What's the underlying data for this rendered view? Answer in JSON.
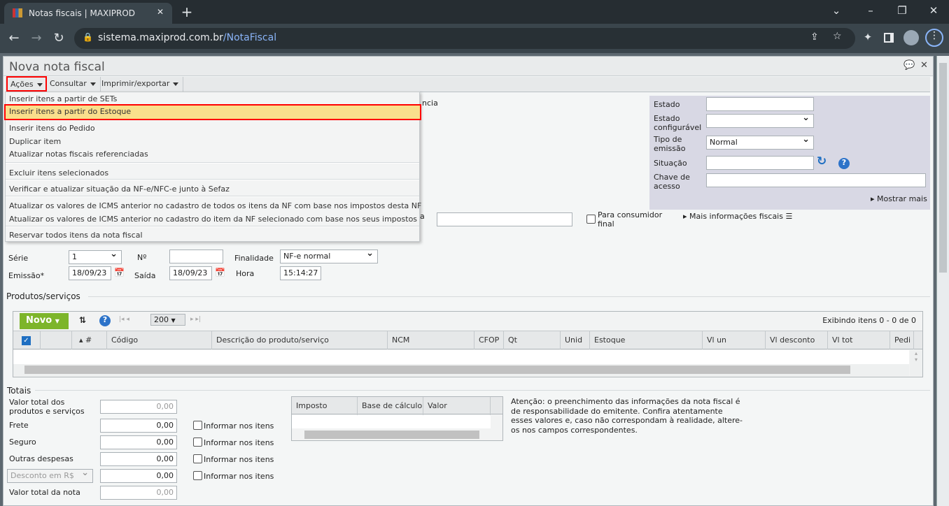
{
  "browser": {
    "tab_title": "Notas fiscais | MAXIPROD",
    "url_host": "sistema.maxiprod.com.br",
    "url_path": "/NotaFiscal"
  },
  "window": {
    "title": "Nova nota fiscal"
  },
  "toolbar": {
    "acoes": "Ações",
    "consultar": "Consultar",
    "imprimir": "Imprimir/exportar"
  },
  "menu": {
    "items": [
      "Inserir itens a partir de SETs",
      "Inserir itens a partir do Estoque",
      "Inserir itens do Pedido",
      "Duplicar item",
      "Atualizar notas fiscais referenciadas",
      "Excluir itens selecionados",
      "Verificar e atualizar situação da NF-e/NFC-e junto à Sefaz",
      "Atualizar os valores de ICMS anterior no cadastro de todos os itens da NF com base nos impostos desta NF",
      "Atualizar os valores de ICMS anterior no cadastro do item da NF selecionado com base nos seus impostos",
      "Reservar todos itens da nota fiscal"
    ]
  },
  "partial": {
    "ncia": "ncia",
    "a": "a"
  },
  "status_panel": {
    "estado": "Estado",
    "estado_conf": "Estado configurável",
    "tipo_emissao": "Tipo de emissão",
    "tipo_emissao_value": "Normal",
    "situacao": "Situação",
    "chave": "Chave de acesso",
    "mostrar_mais": "Mostrar mais"
  },
  "fiscal": {
    "consumidor_final": "Para consumidor final",
    "mais_info": "Mais informações fiscais"
  },
  "header_fields": {
    "serie_label": "Série",
    "serie_value": "1",
    "numero_label": "Nº",
    "finalidade_label": "Finalidade",
    "finalidade_value": "NF-e normal",
    "emissao_label": "Emissão*",
    "emissao_value": "18/09/23",
    "saida_label": "Saída",
    "saida_value": "18/09/23",
    "hora_label": "Hora",
    "hora_value": "15:14:27"
  },
  "products": {
    "section": "Produtos/serviços",
    "novo": "Novo",
    "page_size": "200",
    "status": "Exibindo itens 0 - 0 de 0",
    "columns": [
      "#",
      "Código",
      "Descrição do produto/serviço",
      "NCM",
      "CFOP",
      "Qt",
      "Unid",
      "Estoque",
      "Vl un",
      "Vl desconto",
      "Vl tot",
      "Pedi"
    ]
  },
  "totais": {
    "section": "Totais",
    "valor_produtos": "Valor total dos produtos e serviços",
    "valor_produtos_value": "0,00",
    "frete": "Frete",
    "frete_value": "0,00",
    "seguro": "Seguro",
    "seguro_value": "0,00",
    "outras": "Outras despesas",
    "outras_value": "0,00",
    "desconto_select": "Desconto em R$",
    "desconto_value": "0,00",
    "valor_nota": "Valor total da nota",
    "valor_nota_value": "0,00",
    "informar": "Informar nos itens"
  },
  "impostos": {
    "columns": [
      "Imposto",
      "Base de cálculo",
      "Valor"
    ]
  },
  "notice": "Atenção: o preenchimento das informações da nota fiscal é de responsabilidade do emitente. Confira atentamente esses valores e, caso não correspondam à realidade, altere-os nos campos correspondentes."
}
